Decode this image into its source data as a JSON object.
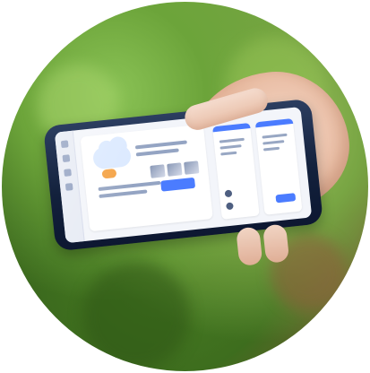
{
  "scene": {
    "subject": "",
    "background": "",
    "accent_blue": "#4d7cff",
    "skin_tone": "#e8bfa8",
    "phone_color": "#14213b"
  }
}
